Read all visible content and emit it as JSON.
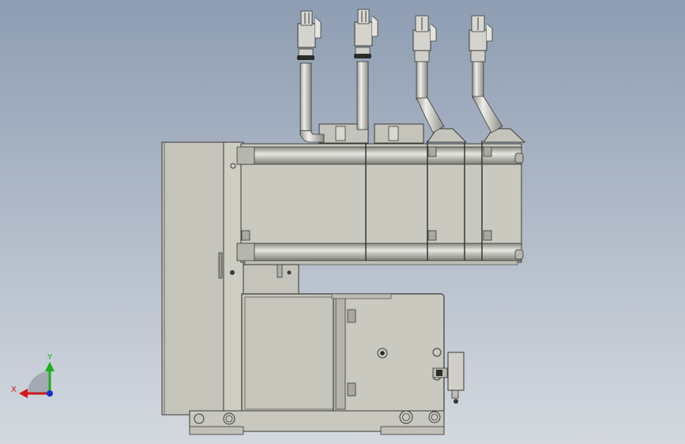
{
  "viewport": {
    "background_top": "#8e9db3",
    "background_bottom": "#d4d9df",
    "part_fill": "#c8c8be",
    "part_shade": "#a9a9a0",
    "part_edge": "#3a3a36",
    "cable_fill": "#c9c9c2"
  },
  "triad": {
    "x_label": "X",
    "y_label": "Y",
    "x_color": "#d01818",
    "y_color": "#18b018",
    "z_color": "#1830d0"
  },
  "connectors": [
    {
      "style": "straight"
    },
    {
      "style": "straight"
    },
    {
      "style": "angled"
    },
    {
      "style": "angled"
    }
  ]
}
